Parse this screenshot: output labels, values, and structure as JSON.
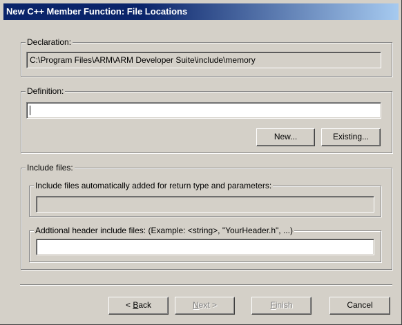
{
  "window": {
    "title": "New C++ Member Function: File Locations"
  },
  "declaration": {
    "legend": "Declaration:",
    "value": "C:\\Program Files\\ARM\\ARM Developer Suite\\include\\memory"
  },
  "definition": {
    "legend": "Definition:",
    "value": "",
    "new_label": "New...",
    "existing_label": "Existing..."
  },
  "include_files": {
    "legend": "Include files:",
    "auto": {
      "legend": "Include files automatically added for return type and parameters:",
      "value": ""
    },
    "additional": {
      "legend": "Addtional header include files: (Example: <string>, \"YourHeader.h\", ...)",
      "value": ""
    }
  },
  "buttons": {
    "back_mnemonic": "B",
    "back_rest": "ack",
    "back_prefix": "< ",
    "next_mnemonic": "N",
    "next_rest": "ext >",
    "finish_mnemonic": "F",
    "finish_rest": "inish",
    "cancel_label": "Cancel"
  },
  "colors": {
    "face": "#d4d0c8",
    "title_start": "#0a246a",
    "title_end": "#a6caf0",
    "disabled_text": "#808080"
  }
}
